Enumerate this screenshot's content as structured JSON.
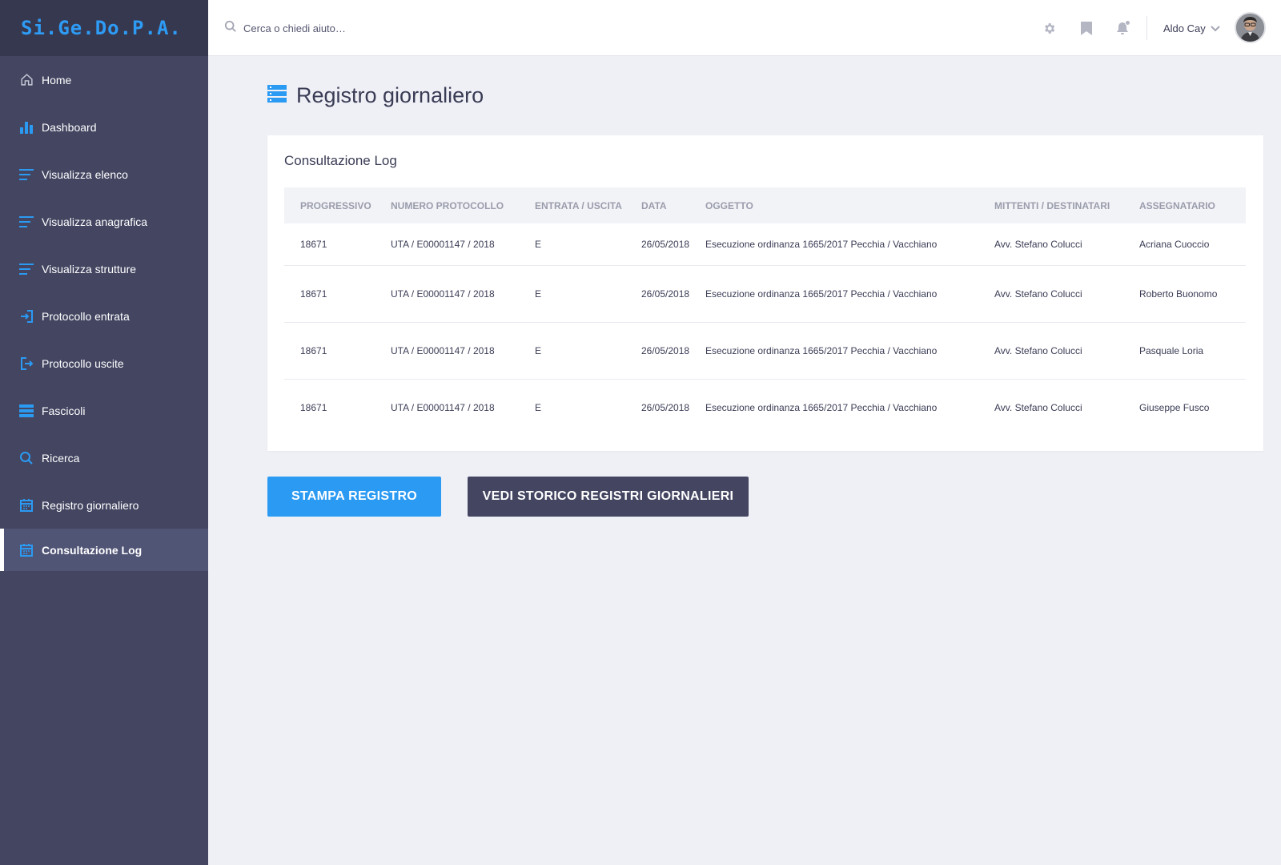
{
  "app": {
    "logo": "Si.Ge.Do.P.A."
  },
  "sidebar": {
    "items": [
      {
        "label": "Home",
        "icon": "home-icon"
      },
      {
        "label": "Dashboard",
        "icon": "bar-chart-icon"
      },
      {
        "label": "Visualizza elenco",
        "icon": "list-icon"
      },
      {
        "label": "Visualizza anagrafica",
        "icon": "list-icon"
      },
      {
        "label": "Visualizza strutture",
        "icon": "list-icon"
      },
      {
        "label": "Protocollo entrata",
        "icon": "sign-in-icon"
      },
      {
        "label": "Protocollo uscite",
        "icon": "sign-out-icon"
      },
      {
        "label": "Fascicoli",
        "icon": "server-stack-icon"
      },
      {
        "label": "Ricerca",
        "icon": "search-icon"
      },
      {
        "label": "Registro giornaliero",
        "icon": "calendar-icon"
      },
      {
        "label": "Consultazione Log",
        "icon": "calendar-icon",
        "active": true
      }
    ]
  },
  "header": {
    "search_placeholder": "Cerca o chiedi aiuto…",
    "user_name": "Aldo Cay"
  },
  "page": {
    "title": "Registro giornaliero"
  },
  "log": {
    "title": "Consultazione Log",
    "columns": [
      "Progressivo",
      "Numero Protocollo",
      "Entrata / Uscita",
      "Data",
      "Oggetto",
      "Mittenti / Destinatari",
      "Assegnatario"
    ],
    "rows": [
      [
        "18671",
        "UTA / E00001147 / 2018",
        "E",
        "26/05/2018",
        "Esecuzione ordinanza 1665/2017 Pecchia / Vacchiano",
        "Avv. Stefano Colucci",
        "Acriana Cuoccio"
      ],
      [
        "18671",
        "UTA / E00001147 / 2018",
        "E",
        "26/05/2018",
        "Esecuzione ordinanza 1665/2017 Pecchia / Vacchiano",
        "Avv. Stefano Colucci",
        "Roberto Buonomo"
      ],
      [
        "18671",
        "UTA / E00001147 / 2018",
        "E",
        "26/05/2018",
        "Esecuzione ordinanza 1665/2017 Pecchia / Vacchiano",
        "Avv. Stefano Colucci",
        "Pasquale Loria"
      ],
      [
        "18671",
        "UTA / E00001147 / 2018",
        "E",
        "26/05/2018",
        "Esecuzione ordinanza 1665/2017 Pecchia / Vacchiano",
        "Avv. Stefano Colucci",
        "Giuseppe Fusco"
      ]
    ]
  },
  "actions": {
    "print_label": "STAMPA REGISTRO",
    "history_label": "VEDI STORICO REGISTRI GIORNALIERI"
  },
  "colors": {
    "accent": "#2b9af3",
    "sidebar": "#434561",
    "sidebar_active": "#505475",
    "background": "#eff0f6"
  }
}
